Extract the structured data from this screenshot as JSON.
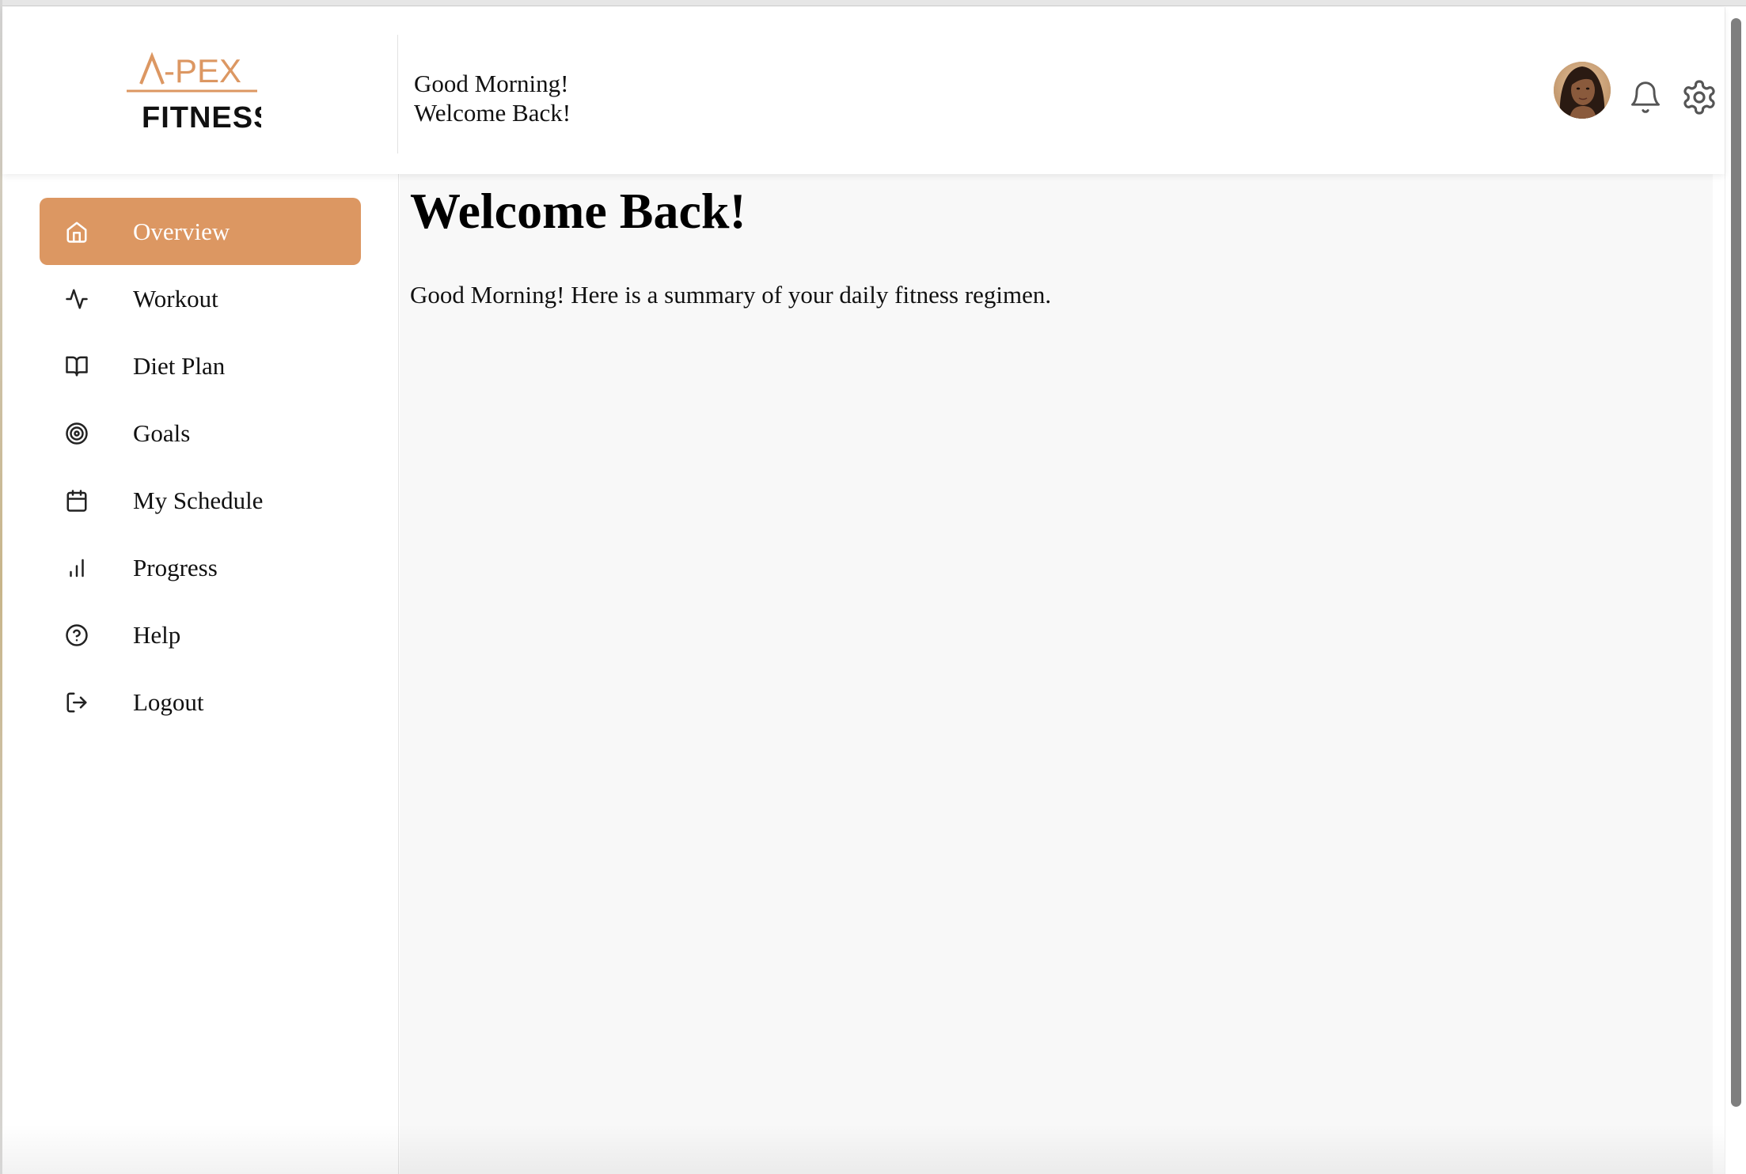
{
  "brand": {
    "logo_top": "A-PEX",
    "logo_bottom": "FITNESS",
    "accent_color": "#dc9762"
  },
  "header": {
    "greeting_line1": "Good Morning!",
    "greeting_line2": "Welcome Back!",
    "icons": [
      "user-avatar",
      "bell-icon",
      "gear-icon"
    ]
  },
  "sidebar": {
    "items": [
      {
        "label": "Overview",
        "icon": "home-icon",
        "active": true
      },
      {
        "label": "Workout",
        "icon": "activity-icon",
        "active": false
      },
      {
        "label": "Diet Plan",
        "icon": "book-open-icon",
        "active": false
      },
      {
        "label": "Goals",
        "icon": "target-icon",
        "active": false
      },
      {
        "label": "My Schedule",
        "icon": "calendar-icon",
        "active": false
      },
      {
        "label": "Progress",
        "icon": "bar-chart-icon",
        "active": false
      },
      {
        "label": "Help",
        "icon": "help-circle-icon",
        "active": false
      },
      {
        "label": "Logout",
        "icon": "logout-icon",
        "active": false
      }
    ]
  },
  "main": {
    "title": "Welcome Back!",
    "subtitle": "Good Morning! Here is a summary of your daily fitness regimen."
  }
}
